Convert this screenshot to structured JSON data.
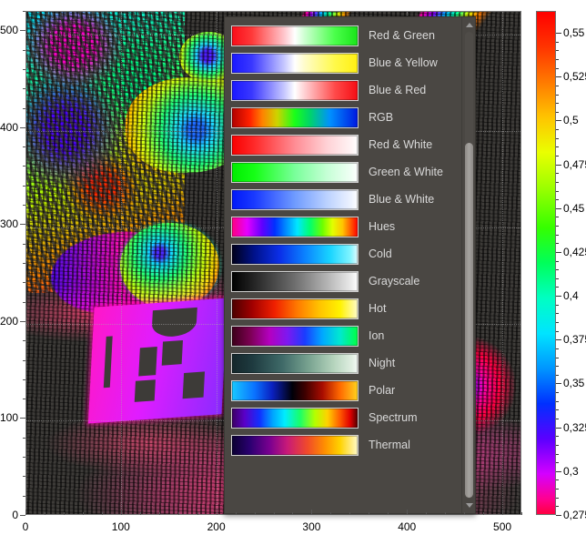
{
  "plot": {
    "bg_color": "#3d3b38",
    "x_axis": {
      "ticks": [
        0,
        100,
        200,
        300,
        400,
        500
      ],
      "min": 0,
      "max": 520
    },
    "y_axis": {
      "ticks": [
        0,
        100,
        200,
        300,
        400,
        500
      ],
      "min": 0,
      "max": 520
    }
  },
  "colorbar": {
    "ticks": [
      "0,55",
      "0,525",
      "0,5",
      "0,475",
      "0,45",
      "0,425",
      "0,4",
      "0,375",
      "0,35",
      "0,325",
      "0,3",
      "0,275"
    ],
    "tick_values": [
      0.55,
      0.525,
      0.5,
      0.475,
      0.45,
      0.425,
      0.4,
      0.375,
      0.35,
      0.325,
      0.3,
      0.275
    ],
    "min": 0.275,
    "max": 0.5625,
    "gradient_name": "Hues",
    "gradient_top": "#ff0000",
    "gradient_bottom": "#ff0040"
  },
  "dropdown": {
    "name": "colormap-selector",
    "scroll_up_icon": "triangle-up-icon",
    "scroll_down_icon": "triangle-down-icon",
    "items": [
      {
        "label": "Red & Green",
        "gradient": "linear-gradient(to right,#fa0c18 0%,#ff3a3a 16%,#ffc9cf 42%,#ffffff 50%,#ccffd0 58%,#4aff4a 82%,#19e519 100%)"
      },
      {
        "label": "Blue & Yellow",
        "gradient": "linear-gradient(to right,#1a18ff 0%,#3a38ff 16%,#c9caff 42%,#ffffff 50%,#fffcc9 58%,#fff94a 82%,#ffef12 100%)"
      },
      {
        "label": "Blue & Red",
        "gradient": "linear-gradient(to right,#1a18ff 0%,#3a38ff 16%,#c9caff 42%,#ffffff 50%,#ffcfd2 58%,#ff4a4a 82%,#f50d14 100%)"
      },
      {
        "label": "RGB",
        "gradient": "linear-gradient(to right,#b00000 0%,#ff2000 14%,#ff8000 24%,#cdd400 36%,#19ff19 50%,#00d46a 62%,#0090ff 78%,#0018e0 100%)"
      },
      {
        "label": "Red & White",
        "gradient": "linear-gradient(to right,#f80000 0%,#ff2a2a 18%,#ff8c94 50%,#ffd2d6 76%,#fff4f5 95%,#ffffff 100%)"
      },
      {
        "label": "Green & White",
        "gradient": "linear-gradient(to right,#00ee00 0%,#16ff16 18%,#79ff9a 50%,#c6ffd6 76%,#f1fff5 95%,#ffffff 100%)"
      },
      {
        "label": "Blue & White",
        "gradient": "linear-gradient(to right,#0018f8 0%,#1a3aff 18%,#6f9bff 50%,#bcd2ff 76%,#eef3ff 95%,#ffffff 100%)"
      },
      {
        "label": "Hues",
        "gradient": "linear-gradient(to right,#ff0080 0%,#e400ff 12%,#6000ff 24%,#0030ff 34%,#0096ff 44%,#00e7ff 52%,#00ff6f 62%,#6cff00 72%,#e2ff00 80%,#ffc400 88%,#ff5200 95%,#ff0000 100%)"
      },
      {
        "label": "Cold",
        "gradient": "linear-gradient(to right,#000019 0%,#00128c 18%,#0b2fe8 38%,#0b82ff 58%,#18d4ff 78%,#7ff4ff 94%,#dffbff 100%)"
      },
      {
        "label": "Grayscale",
        "gradient": "linear-gradient(to right,#000000 0%,#2a2a2a 20%,#6e6e6e 50%,#b4b4b4 76%,#e8e8e8 94%,#ffffff 100%)"
      },
      {
        "label": "Hot",
        "gradient": "linear-gradient(to right,#4a0000 0%,#a00000 16%,#f02000 34%,#ff7a00 52%,#ffc400 70%,#fff200 86%,#fffbc8 100%)"
      },
      {
        "label": "Ion",
        "gradient": "linear-gradient(to right,#3a0018 0%,#7a0050 14%,#b400c0 30%,#7e18f0 44%,#1a3cff 58%,#00a8ff 72%,#00e8d0 86%,#00ff46 100%)"
      },
      {
        "label": "Night",
        "gradient": "linear-gradient(to right,#15272b 0%,#1e3a3f 16%,#3f6a68 40%,#7ba592 62%,#b8d6bf 82%,#e2f0e4 96%,#f5fbf6 100%)"
      },
      {
        "label": "Polar",
        "gradient": "linear-gradient(to right,#18c8ff 0%,#0a72ff 18%,#0a20c0 32%,#000008 48%,#3c0000 58%,#a80c00 72%,#ff6a00 86%,#ffd21e 100%)"
      },
      {
        "label": "Spectrum",
        "gradient": "linear-gradient(to right,#3a0060 0%,#5a00c8 10%,#1030ff 22%,#00a0ff 32%,#00ecff 42%,#18ff6a 54%,#b4ff00 66%,#ffd200 76%,#ff5a00 86%,#e00000 94%,#520000 100%)"
      },
      {
        "label": "Thermal",
        "gradient": "linear-gradient(to right,#0a0030 0%,#2a0070 14%,#7a0090 30%,#c81a78 44%,#f04a2a 60%,#ff9000 74%,#ffd200 86%,#fffac8 100%)"
      }
    ]
  }
}
